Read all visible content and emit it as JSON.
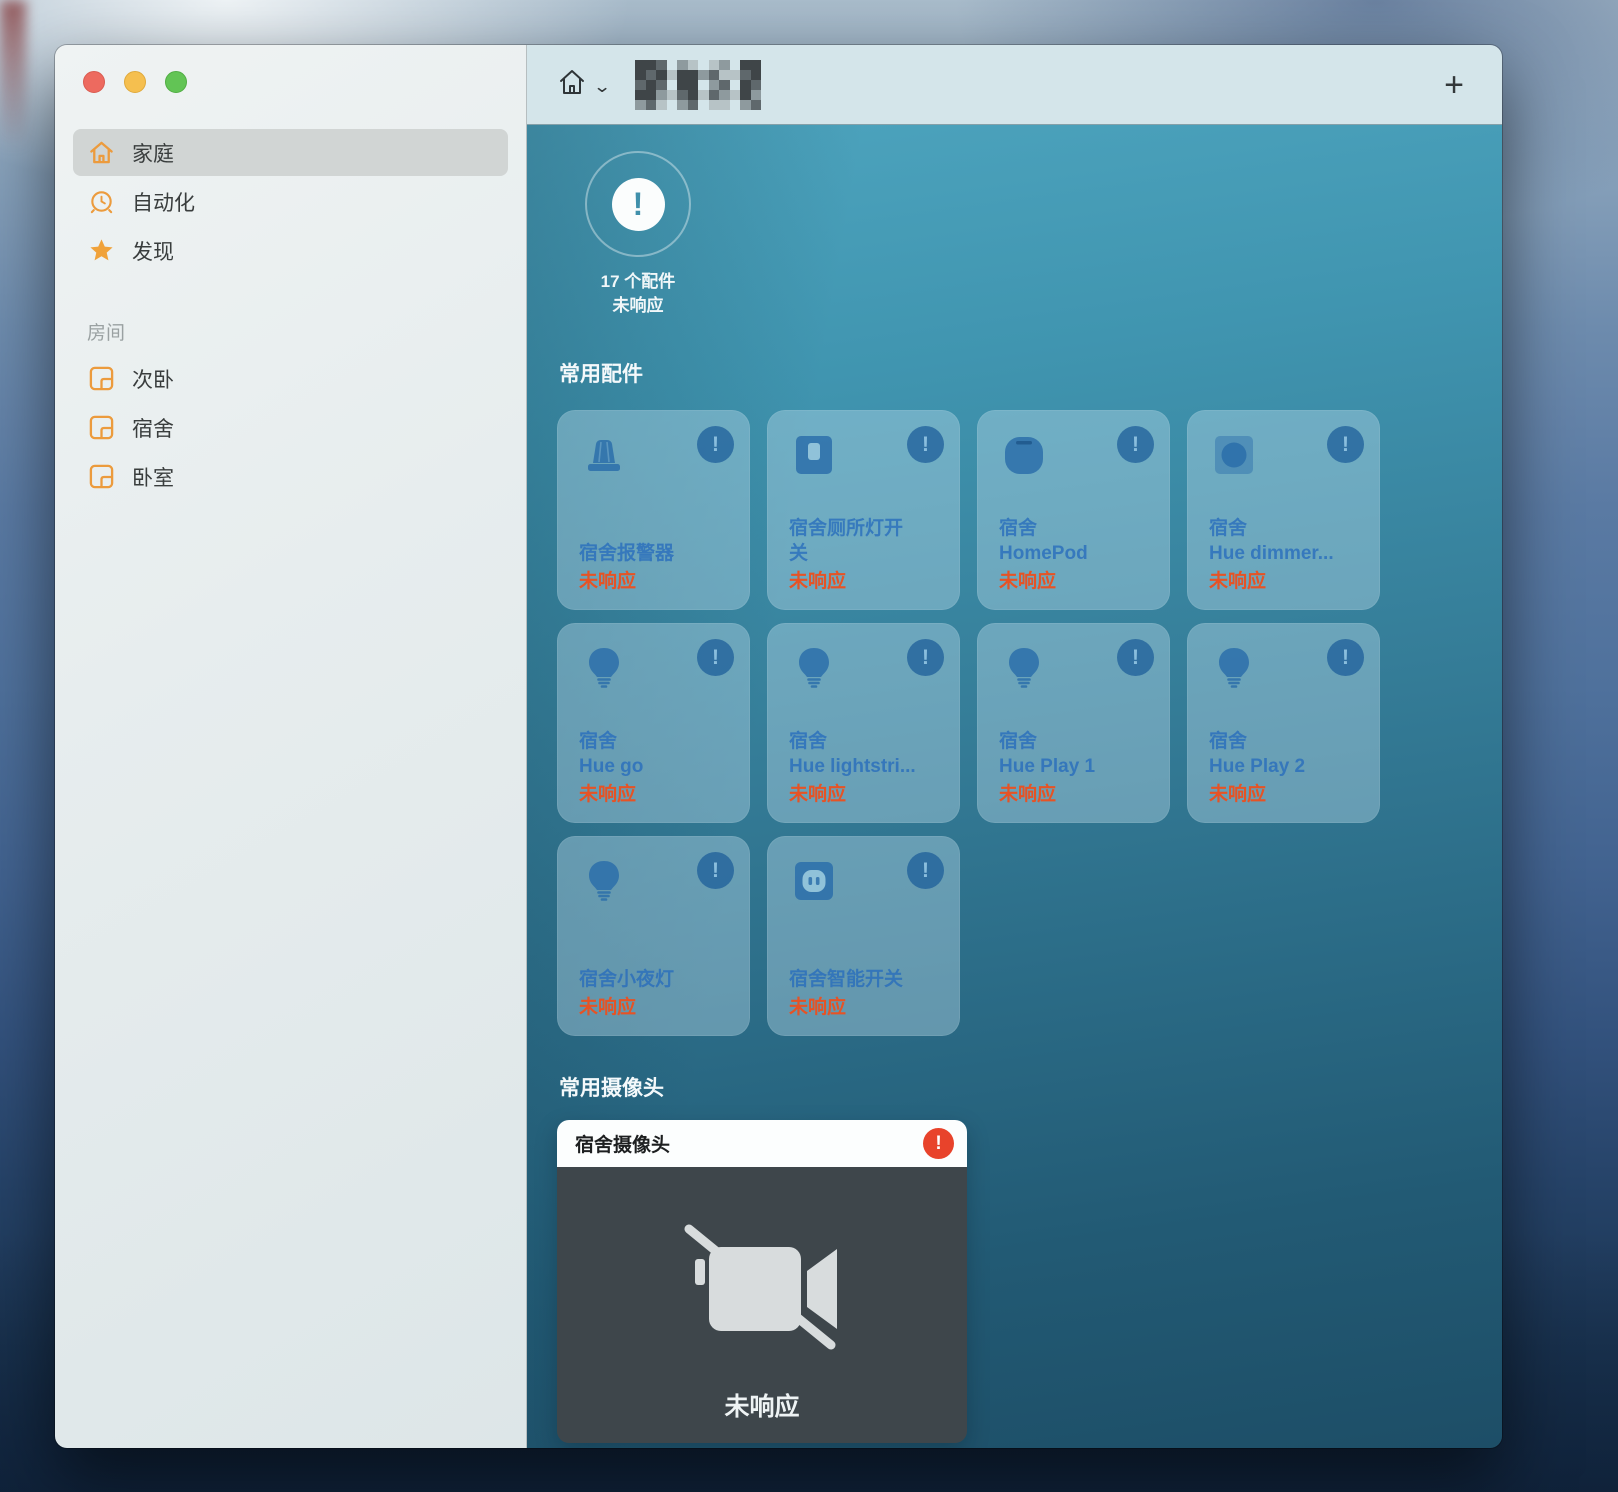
{
  "window": {
    "toolbar": {
      "home_menu_icon": "house-icon",
      "chevron_icon": "chevron-down-icon",
      "title_redacted": true,
      "add_button_label": "+"
    }
  },
  "sidebar": {
    "nav": [
      {
        "key": "home",
        "icon": "house-icon",
        "label": "家庭",
        "selected": true
      },
      {
        "key": "automation",
        "icon": "clock-icon",
        "label": "自动化",
        "selected": false
      },
      {
        "key": "discover",
        "icon": "star-icon",
        "label": "发现",
        "selected": false
      }
    ],
    "rooms_header": "房间",
    "rooms": [
      {
        "key": "second-bedroom",
        "icon": "room-icon",
        "label": "次卧"
      },
      {
        "key": "dorm",
        "icon": "room-icon",
        "label": "宿舍"
      },
      {
        "key": "bedroom",
        "icon": "room-icon",
        "label": "卧室"
      }
    ]
  },
  "main": {
    "alert_glyph": "!",
    "alert_summary": {
      "line1": "17 个配件",
      "line2": "未响应"
    },
    "sections": {
      "accessories": "常用配件",
      "cameras": "常用摄像头"
    },
    "tiles": [
      {
        "key": "alarm",
        "icon": "siren-icon",
        "name_lines": [
          "宿舍报警器"
        ],
        "status": "未响应"
      },
      {
        "key": "toilet-light-switch",
        "icon": "switch-icon",
        "name_lines": [
          "宿舍厕所灯开",
          "关"
        ],
        "status": "未响应"
      },
      {
        "key": "homepod",
        "icon": "homepod-icon",
        "name_lines": [
          "宿舍",
          "HomePod"
        ],
        "status": "未响应"
      },
      {
        "key": "hue-dimmer",
        "icon": "dimmer-icon",
        "name_lines": [
          "宿舍",
          "Hue dimmer..."
        ],
        "status": "未响应"
      },
      {
        "key": "hue-go",
        "icon": "bulb-icon",
        "name_lines": [
          "宿舍",
          "Hue go"
        ],
        "status": "未响应"
      },
      {
        "key": "hue-lightstrip",
        "icon": "bulb-icon",
        "name_lines": [
          "宿舍",
          "Hue lightstri..."
        ],
        "status": "未响应"
      },
      {
        "key": "hue-play-1",
        "icon": "bulb-icon",
        "name_lines": [
          "宿舍",
          "Hue Play 1"
        ],
        "status": "未响应"
      },
      {
        "key": "hue-play-2",
        "icon": "bulb-icon",
        "name_lines": [
          "宿舍",
          "Hue Play 2"
        ],
        "status": "未响应"
      },
      {
        "key": "night-light",
        "icon": "bulb-icon",
        "name_lines": [
          "宿舍小夜灯"
        ],
        "status": "未响应"
      },
      {
        "key": "smart-switch",
        "icon": "outlet-icon",
        "name_lines": [
          "宿舍智能开关"
        ],
        "status": "未响应"
      }
    ],
    "camera": {
      "name": "宿舍摄像头",
      "status": "未响应",
      "icon": "video-camera-slash-icon",
      "badge_icon": "alert-badge-icon"
    }
  },
  "colors": {
    "accent_orange": "#ec9b3d",
    "status_red": "#e65325",
    "alert_badge_red": "#e8432b",
    "tile_blue": "#276cbc",
    "content_teal_top": "#4da4be",
    "content_teal_bottom": "#1d4e67"
  }
}
